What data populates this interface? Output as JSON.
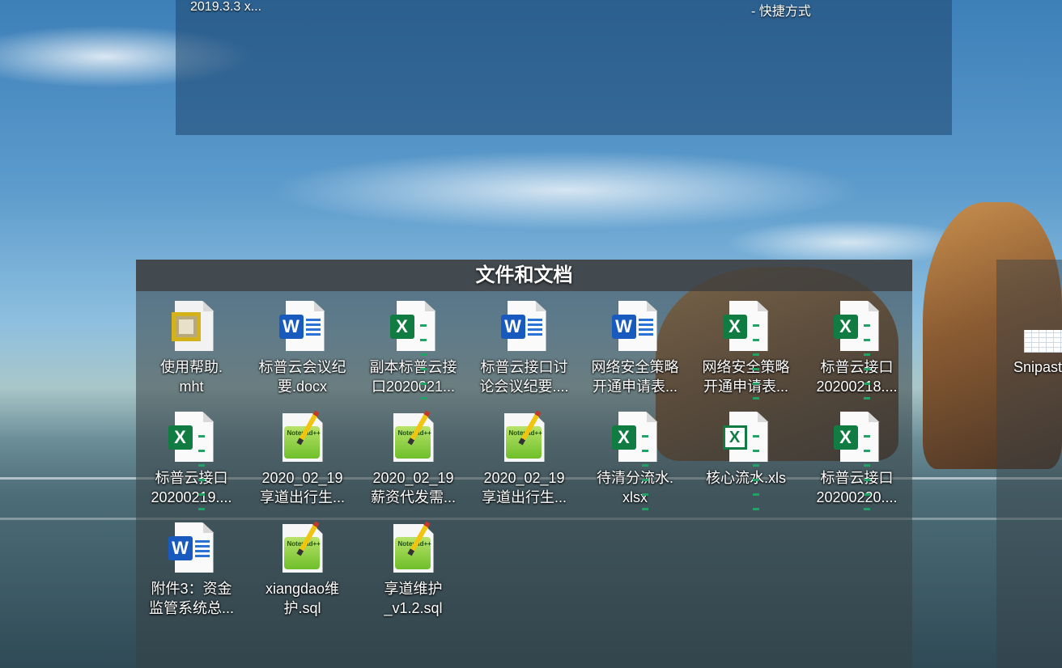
{
  "top_fence": {
    "fragment_left": "2019.3.3 x...",
    "fragment_right": "- 快捷方式"
  },
  "fence": {
    "title": "文件和文档",
    "items": [
      {
        "type": "mht",
        "line1": "使用帮助.",
        "line2": "mht"
      },
      {
        "type": "word",
        "line1": "标普云会议纪",
        "line2": "要.docx"
      },
      {
        "type": "excel",
        "line1": "副本标普云接",
        "line2": "口2020021..."
      },
      {
        "type": "word",
        "line1": "标普云接口讨",
        "line2": "论会议纪要...."
      },
      {
        "type": "word",
        "line1": "网络安全策略",
        "line2": "开通申请表..."
      },
      {
        "type": "excel",
        "line1": "网络安全策略",
        "line2": "开通申请表..."
      },
      {
        "type": "excel",
        "line1": "标普云接口",
        "line2": "20200218...."
      },
      {
        "type": "excel",
        "line1": "标普云接口",
        "line2": "20200219...."
      },
      {
        "type": "npp",
        "line1": "2020_02_19",
        "line2": "享道出行生..."
      },
      {
        "type": "npp",
        "line1": "2020_02_19",
        "line2": "薪资代发需..."
      },
      {
        "type": "npp",
        "line1": "2020_02_19",
        "line2": "享道出行生..."
      },
      {
        "type": "excel",
        "line1": "待清分流水.",
        "line2": "xlsx"
      },
      {
        "type": "xls",
        "line1": "核心流水.xls",
        "line2": ""
      },
      {
        "type": "excel",
        "line1": "标普云接口",
        "line2": "20200220...."
      },
      {
        "type": "word",
        "line1": "附件3：资金",
        "line2": "监管系统总..."
      },
      {
        "type": "npp",
        "line1": "xiangdao维",
        "line2": "护.sql"
      },
      {
        "type": "npp",
        "line1": "享道维护",
        "line2": "_v1.2.sql"
      }
    ]
  },
  "right_fence": {
    "item_label": "Snipast"
  },
  "icon_names": {
    "word": "word-document-icon",
    "excel": "excel-spreadsheet-icon",
    "xls": "excel-legacy-icon",
    "mht": "mht-web-archive-icon",
    "npp": "notepad-plus-plus-icon"
  },
  "colors": {
    "word": "#185abd",
    "excel": "#107c41",
    "fence_title_bg": "#3c3c3c"
  }
}
